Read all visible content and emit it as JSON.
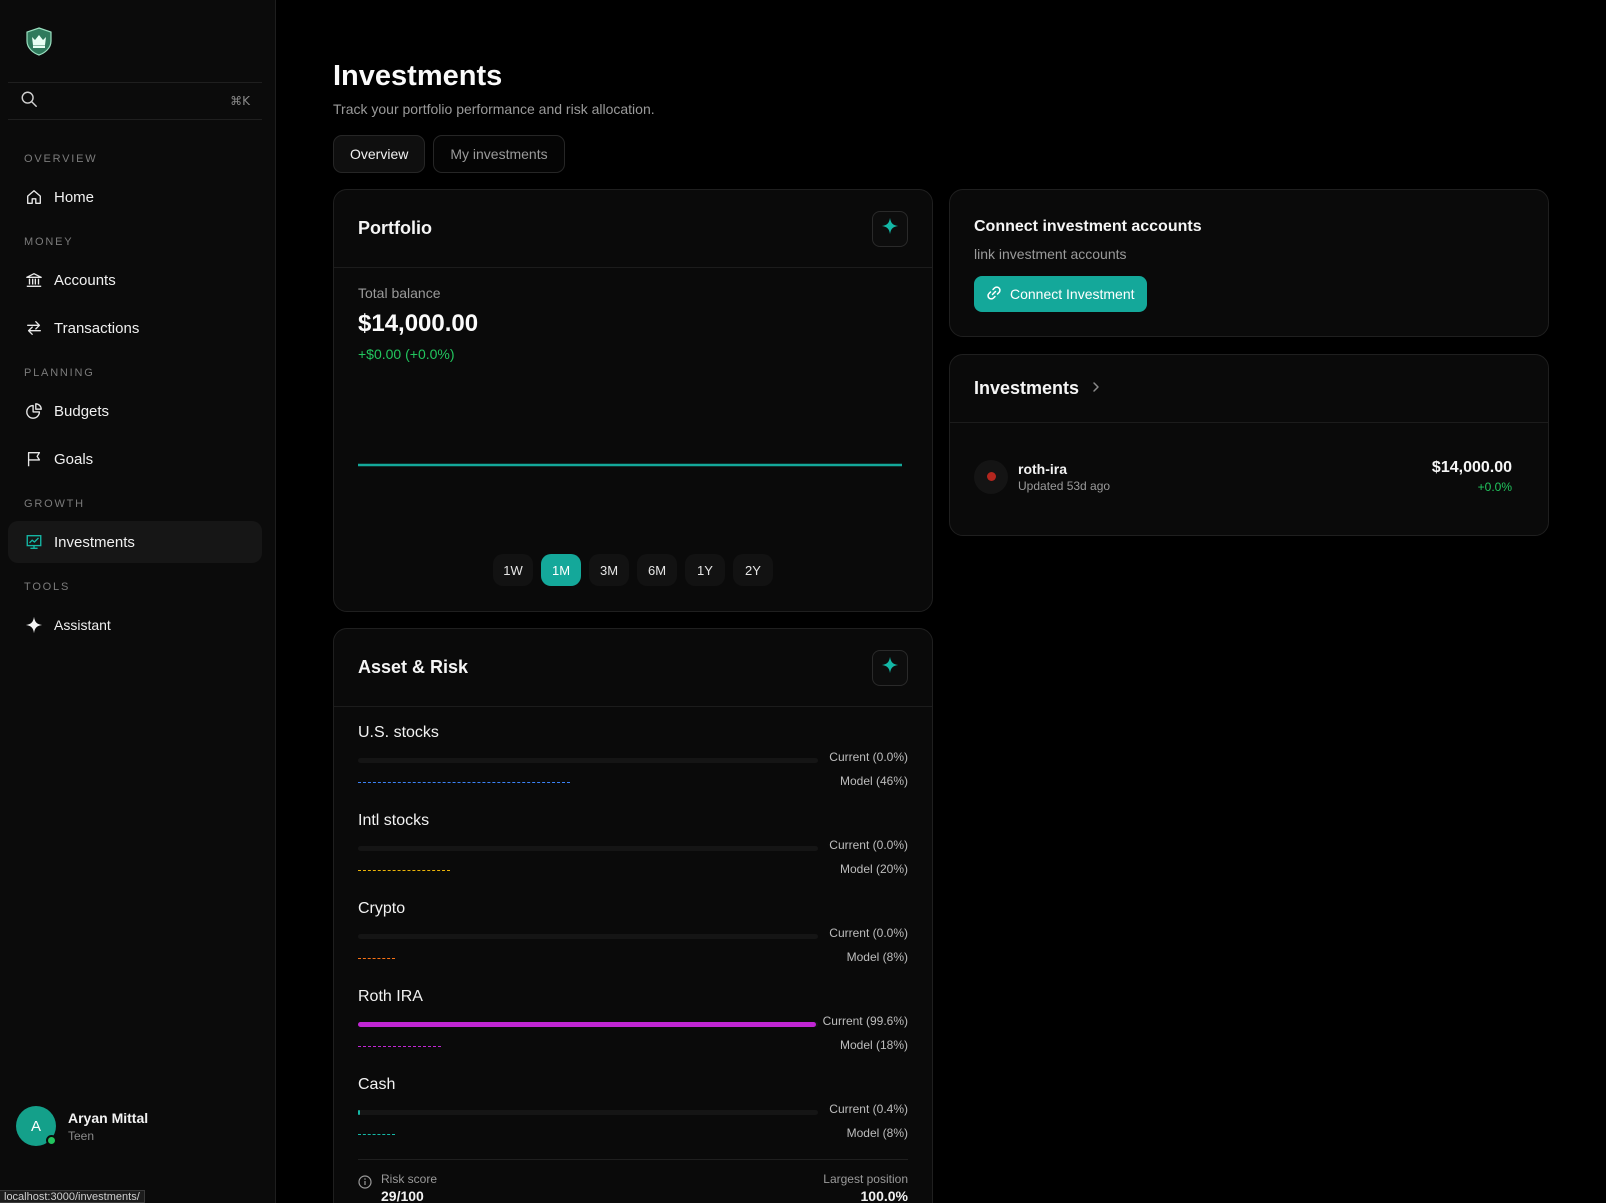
{
  "sidebar": {
    "search_shortcut": "⌘K",
    "sections": {
      "overview": "OVERVIEW",
      "money": "MONEY",
      "planning": "PLANNING",
      "growth": "GROWTH",
      "tools": "TOOLS"
    },
    "items": {
      "home": "Home",
      "accounts": "Accounts",
      "transactions": "Transactions",
      "budgets": "Budgets",
      "goals": "Goals",
      "investments": "Investments",
      "assistant": "Assistant"
    },
    "user": {
      "initial": "A",
      "name": "Aryan Mittal",
      "role": "Teen"
    },
    "status_url": "localhost:3000/investments/"
  },
  "header": {
    "title": "Investments",
    "subtitle": "Track your portfolio performance and risk allocation.",
    "tabs": [
      "Overview",
      "My investments"
    ]
  },
  "portfolio": {
    "title": "Portfolio",
    "balance_label": "Total balance",
    "balance_value": "$14,000.00",
    "change": "+$0.00 (+0.0%)",
    "ranges": [
      "1W",
      "1M",
      "3M",
      "6M",
      "1Y",
      "2Y"
    ],
    "active_range": "1M"
  },
  "chart_data": {
    "type": "line",
    "x": [
      0,
      1,
      2,
      3,
      4,
      5,
      6,
      7,
      8,
      9,
      10
    ],
    "series": [
      {
        "values": [
          14000,
          14000,
          14000,
          14000,
          14000,
          14000,
          14000,
          14000,
          14000,
          14000,
          14000
        ]
      }
    ],
    "color": "#14a89a"
  },
  "asset_risk": {
    "title": "Asset & Risk",
    "assets": [
      {
        "name": "U.S. stocks",
        "current_label": "Current (0.0%)",
        "model_label": "Model (46%)",
        "current": 0.0,
        "model": 46,
        "color": "#3b82f6"
      },
      {
        "name": "Intl stocks",
        "current_label": "Current (0.0%)",
        "model_label": "Model (20%)",
        "current": 0.0,
        "model": 20,
        "color": "#eab308"
      },
      {
        "name": "Crypto",
        "current_label": "Current (0.0%)",
        "model_label": "Model (8%)",
        "current": 0.0,
        "model": 8,
        "color": "#f97316"
      },
      {
        "name": "Roth IRA",
        "current_label": "Current (99.6%)",
        "model_label": "Model (18%)",
        "current": 99.6,
        "model": 18,
        "color": "#c026d3"
      },
      {
        "name": "Cash",
        "current_label": "Current (0.4%)",
        "model_label": "Model (8%)",
        "current": 0.4,
        "model": 8,
        "color": "#14b8a6"
      }
    ],
    "risk_score_label": "Risk score",
    "risk_score": "29/100",
    "largest_position_label": "Largest position",
    "largest_position": "100.0%"
  },
  "connect": {
    "title": "Connect investment accounts",
    "subtitle": "link investment accounts",
    "button": "Connect Investment"
  },
  "investments_list": {
    "title": "Investments",
    "items": [
      {
        "name": "roth-ira",
        "updated": "Updated 53d ago",
        "amount": "$14,000.00",
        "change": "+0.0%"
      }
    ]
  }
}
